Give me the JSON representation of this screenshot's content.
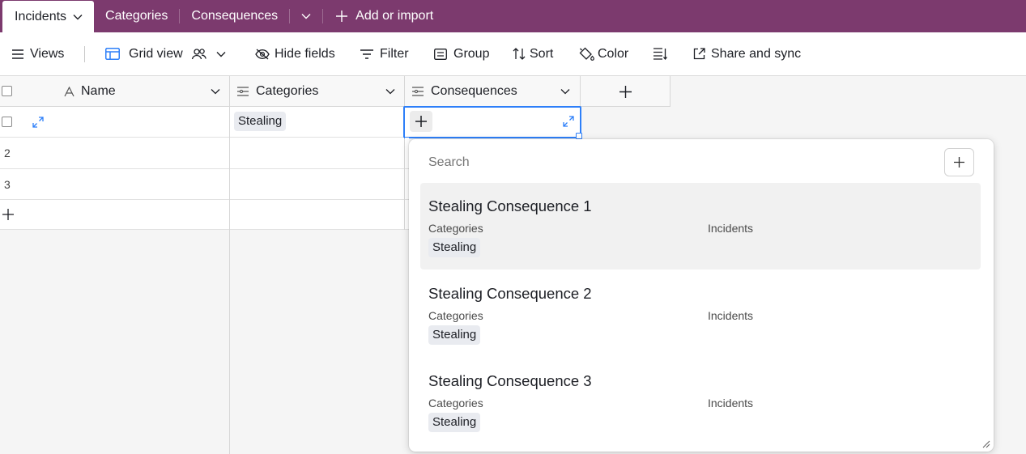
{
  "tabs": {
    "active": "Incidents",
    "others": [
      "Categories",
      "Consequences"
    ],
    "add_label": "Add or import"
  },
  "toolbar": {
    "views": "Views",
    "grid_view": "Grid view",
    "hide_fields": "Hide fields",
    "filter": "Filter",
    "group": "Group",
    "sort": "Sort",
    "color": "Color",
    "share": "Share and sync"
  },
  "grid": {
    "columns": [
      "Name",
      "Categories",
      "Consequences"
    ],
    "rows": [
      {
        "num": "",
        "name": "",
        "category": "Stealing"
      },
      {
        "num": "2",
        "name": "",
        "category": ""
      },
      {
        "num": "3",
        "name": "",
        "category": ""
      }
    ]
  },
  "popup": {
    "search_placeholder": "Search",
    "records": [
      {
        "title": "Stealing Consequence 1",
        "categories_label": "Categories",
        "incidents_label": "Incidents",
        "category": "Stealing"
      },
      {
        "title": "Stealing Consequence 2",
        "categories_label": "Categories",
        "incidents_label": "Incidents",
        "category": "Stealing"
      },
      {
        "title": "Stealing Consequence 3",
        "categories_label": "Categories",
        "incidents_label": "Incidents",
        "category": "Stealing"
      }
    ]
  },
  "colors": {
    "tabbar": "#7c3a6e",
    "accent_blue": "#2d7ff9"
  }
}
